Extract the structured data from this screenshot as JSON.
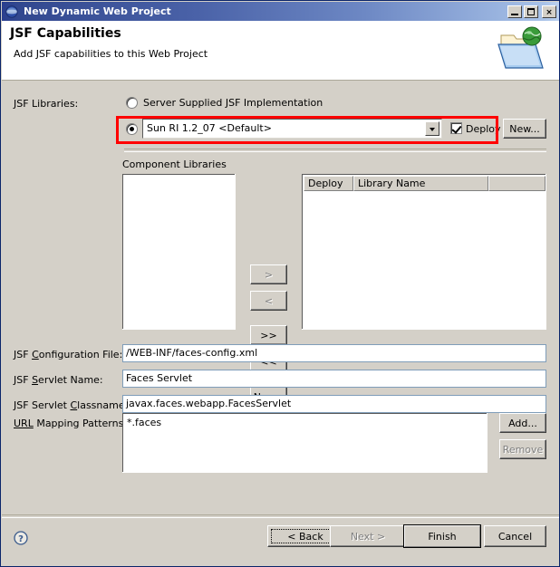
{
  "window": {
    "title": "New Dynamic Web Project",
    "icon": "eclipse-globe-icon",
    "controls": {
      "minimize": "minimize-button",
      "maximize": "maximize-button",
      "close": "×"
    }
  },
  "header": {
    "title": "JSF Capabilities",
    "subtitle": "Add JSF capabilities to this Web Project",
    "icon": "folder-globe-icon"
  },
  "form": {
    "jsf_libraries_label": "JSF Libraries:",
    "server_supplied_option": "Server Supplied JSF Implementation",
    "server_supplied_selected": false,
    "library_option_selected": true,
    "library_combo_value": "Sun RI 1.2_07 <Default>",
    "deploy_label": "Deploy",
    "deploy_checked": true,
    "new_library_button": "New...",
    "component_libraries_label": "Component Libraries",
    "transfer_buttons": [
      {
        "label": ">",
        "name": "move-right-button",
        "disabled": true
      },
      {
        "label": "<",
        "name": "move-left-button",
        "disabled": true
      },
      {
        "label": ">>",
        "name": "move-all-right-button",
        "disabled": false
      },
      {
        "label": "<<",
        "name": "move-all-left-button",
        "disabled": false
      },
      {
        "label": "New...",
        "name": "new-component-library-button",
        "disabled": false
      }
    ],
    "available_list_items": [],
    "selected_table": {
      "columns": [
        "Deploy",
        "Library Name",
        ""
      ],
      "rows": []
    },
    "fields": [
      {
        "label_pre": "JSF ",
        "label_mnemonic": "C",
        "label_post": "onfiguration File:",
        "value": "/WEB-INF/faces-config.xml",
        "name": "jsf-configuration-file-input"
      },
      {
        "label_pre": "JSF ",
        "label_mnemonic": "S",
        "label_post": "ervlet Name:",
        "value": "Faces Servlet",
        "name": "jsf-servlet-name-input"
      },
      {
        "label_pre": "JSF Servlet ",
        "label_mnemonic": "C",
        "label_post": "lassname:",
        "value": "javax.faces.webapp.FacesServlet",
        "name": "jsf-servlet-classname-input"
      }
    ],
    "url_mapping": {
      "label_mnemonic": "URL",
      "label_post": " Mapping Patterns:",
      "items": [
        "*.faces"
      ],
      "add_button": "Add...",
      "remove_button": "Remove",
      "remove_disabled": true
    }
  },
  "footer": {
    "help_icon": "help-question-icon",
    "buttons": [
      {
        "label": "< Back",
        "name": "back-button",
        "disabled": false,
        "focused": true,
        "default": false
      },
      {
        "label": "Next >",
        "name": "next-button",
        "disabled": true,
        "focused": false,
        "default": false
      },
      {
        "label": "Finish",
        "name": "finish-button",
        "disabled": false,
        "focused": false,
        "default": true
      },
      {
        "label": "Cancel",
        "name": "cancel-button",
        "disabled": false,
        "focused": false,
        "default": false
      }
    ]
  },
  "annotation": {
    "highlight_color": "#ff0000",
    "highlight_target": "jsf-library-selection-row"
  },
  "colors": {
    "dialog_background": "#d4d0c8",
    "title_bar_start": "#2a3f8f",
    "title_bar_end": "#bcd2f0",
    "field_background": "#ffffff",
    "disabled_text": "#808080"
  }
}
